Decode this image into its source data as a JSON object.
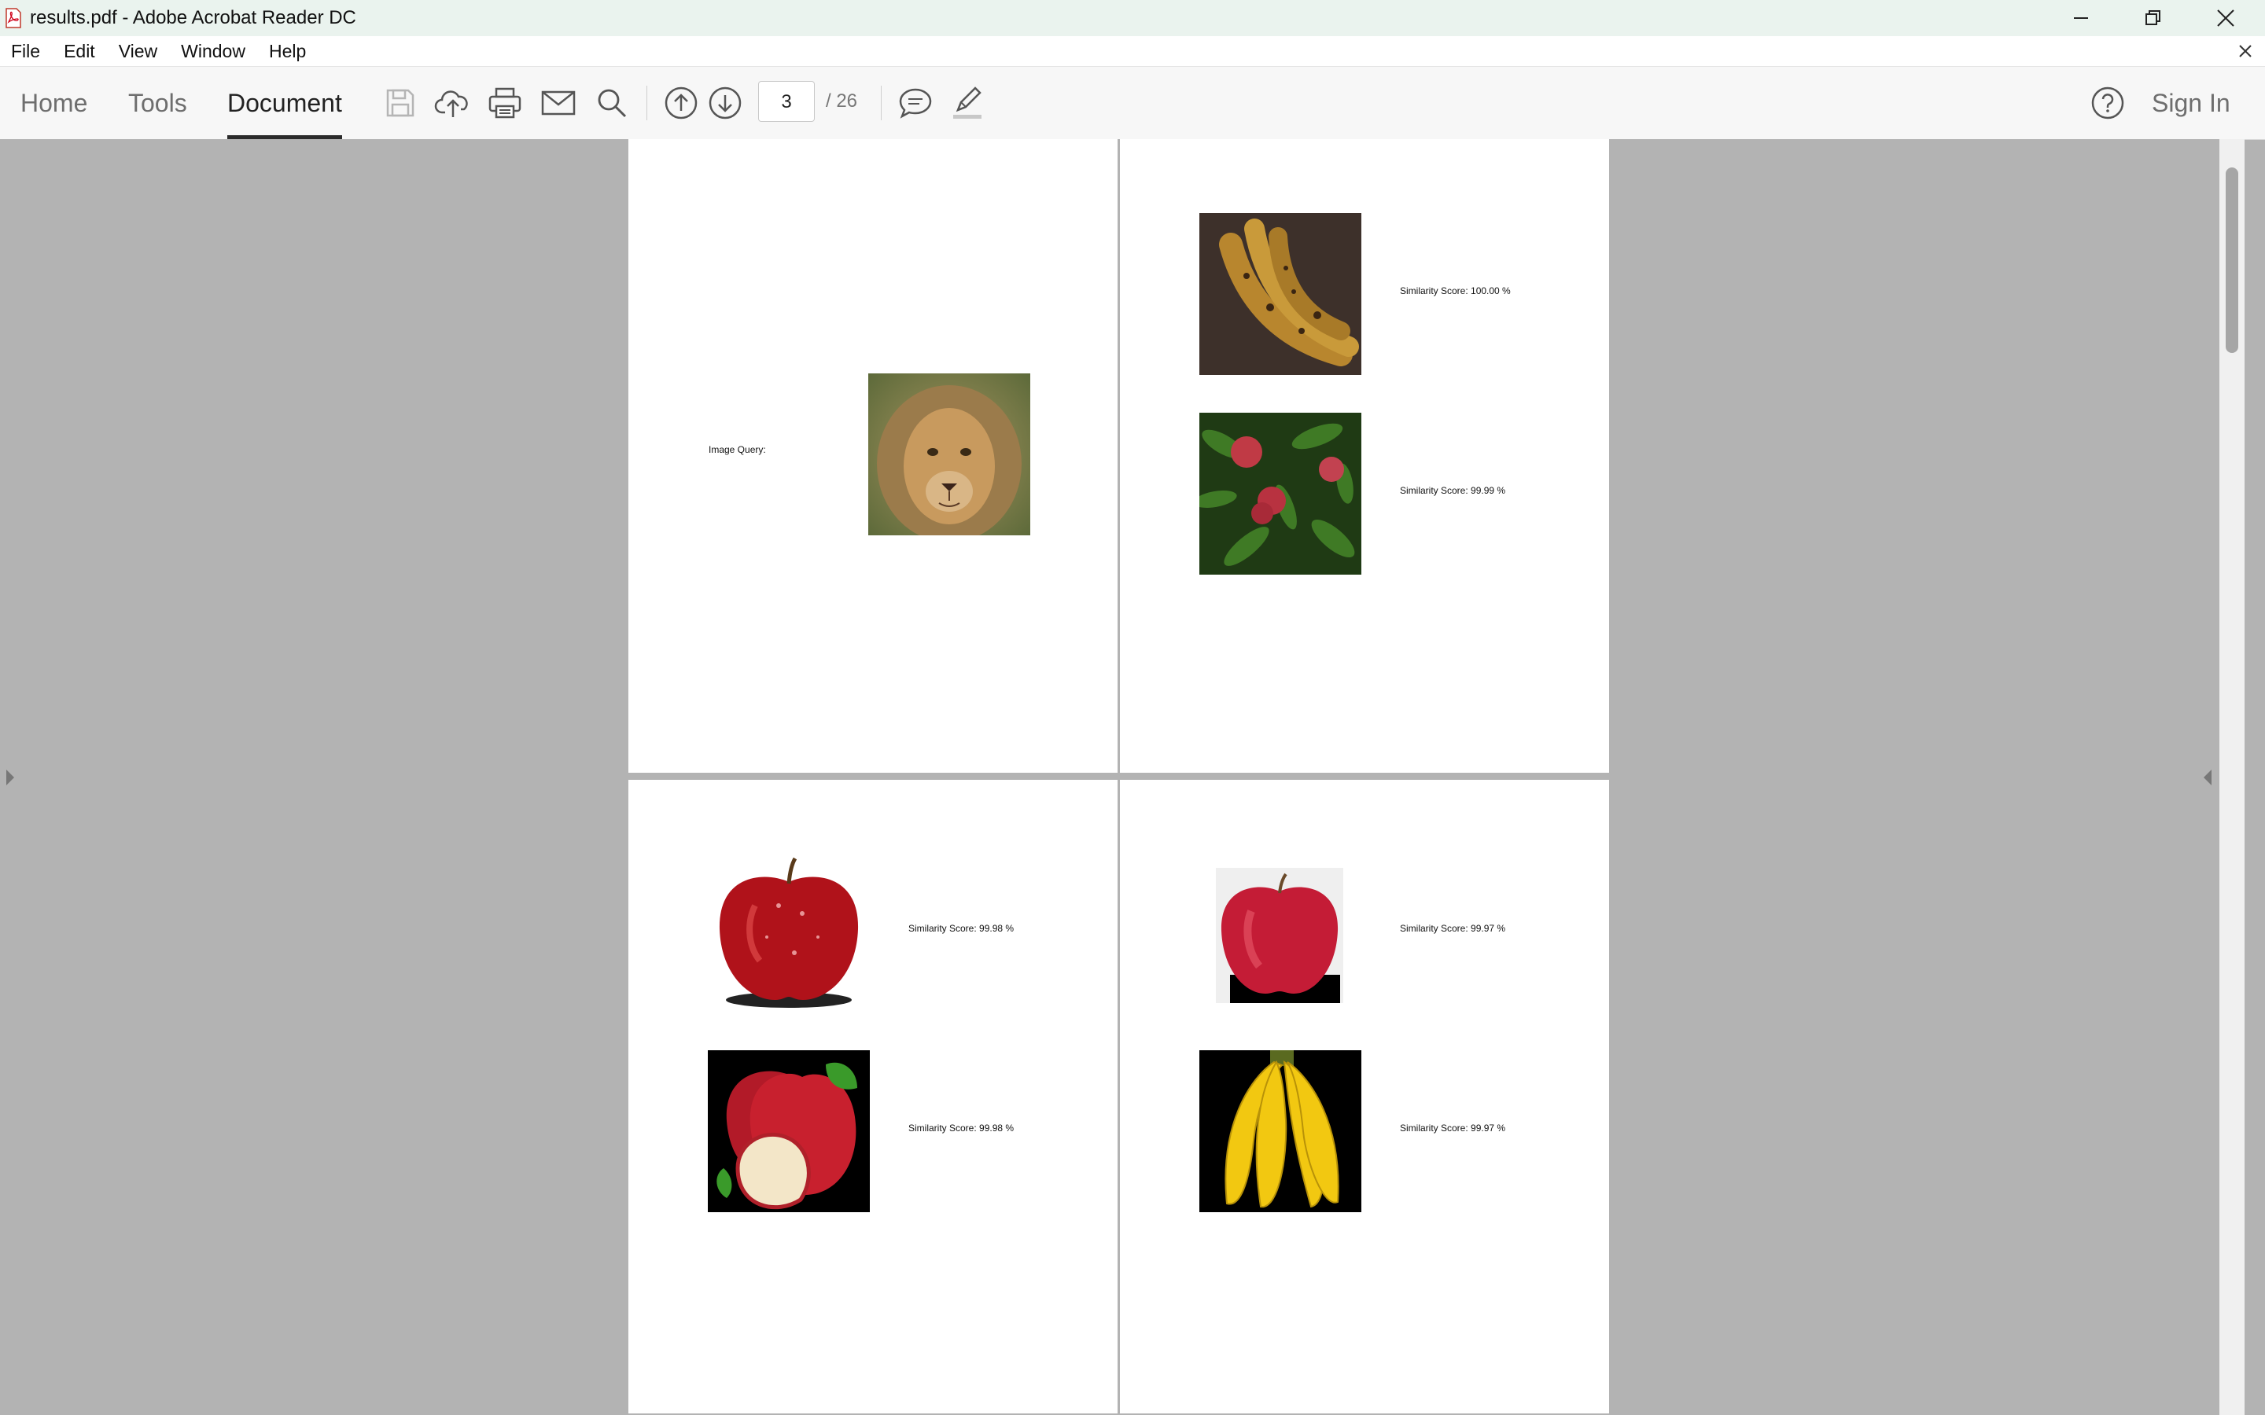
{
  "window": {
    "title": "results.pdf - Adobe Acrobat Reader DC"
  },
  "menubar": {
    "items": [
      "File",
      "Edit",
      "View",
      "Window",
      "Help"
    ]
  },
  "toolbar": {
    "tabs": {
      "home": "Home",
      "tools": "Tools",
      "document": "Document"
    },
    "icons": [
      "save-icon",
      "cloud-upload-icon",
      "print-icon",
      "email-icon",
      "search-icon",
      "page-up-icon",
      "page-down-icon",
      "comment-icon",
      "highlight-pen-icon",
      "help-icon"
    ],
    "current_page": "3",
    "total_pages": "/ 26",
    "sign_in": "Sign In"
  },
  "document": {
    "page_a": {
      "query_label": "Image Query:",
      "query_image": "lion"
    },
    "page_b": {
      "results": [
        {
          "image": "bananas-brown",
          "score": "Similarity Score: 100.00 %"
        },
        {
          "image": "apples-on-tree",
          "score": "Similarity Score: 99.99 %"
        }
      ]
    },
    "page_c": {
      "results": [
        {
          "image": "red-apple-drops",
          "score": "Similarity Score: 99.98 %"
        },
        {
          "image": "apples-with-slice",
          "score": "Similarity Score: 99.98 %"
        }
      ]
    },
    "page_d": {
      "results": [
        {
          "image": "red-apple",
          "score": "Similarity Score: 99.97 %"
        },
        {
          "image": "bananas-yellow",
          "score": "Similarity Score: 99.97 %"
        }
      ]
    }
  },
  "colors": {
    "titlebar_bg": "#eaf3ee",
    "doc_bg": "#b3b3b3",
    "active_tab_underline": "#2b2b2b"
  }
}
